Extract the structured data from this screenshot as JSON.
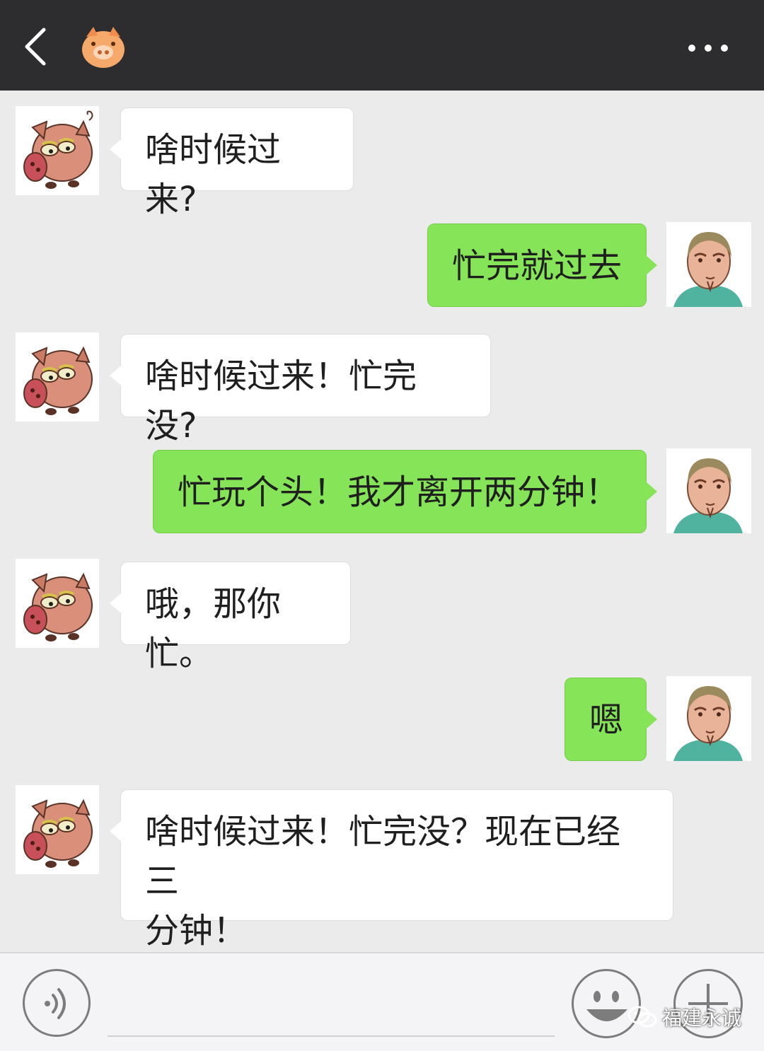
{
  "header": {
    "back_icon": "chevron-left-icon",
    "title_icon": "pig-face-icon",
    "more_icon": "more-dots-icon"
  },
  "colors": {
    "header_bg": "#2d2d2f",
    "chat_bg": "#ebebeb",
    "incoming_bubble": "#ffffff",
    "outgoing_bubble": "#86e458"
  },
  "messages": [
    {
      "side": "in",
      "sender": "pig",
      "lines": [
        "啥时候过来?"
      ]
    },
    {
      "side": "out",
      "sender": "man",
      "lines": [
        "忙完就过去"
      ]
    },
    {
      "side": "in",
      "sender": "pig",
      "lines": [
        "啥时候过来！忙完没?"
      ]
    },
    {
      "side": "out",
      "sender": "man",
      "lines": [
        "忙玩个头！我才离开两分钟！"
      ]
    },
    {
      "side": "in",
      "sender": "pig",
      "lines": [
        "哦，那你忙。"
      ]
    },
    {
      "side": "out",
      "sender": "man",
      "lines": [
        "嗯"
      ]
    },
    {
      "side": "in",
      "sender": "pig",
      "lines": [
        "啥时候过来！忙完没？现在已经三",
        "分钟！"
      ]
    }
  ],
  "input_bar": {
    "voice_icon": "voice-icon",
    "emoji_icon": "smiley-icon",
    "plus_icon": "plus-icon"
  },
  "watermark": {
    "icon": "wechat-icon",
    "text": "福建永诚"
  }
}
